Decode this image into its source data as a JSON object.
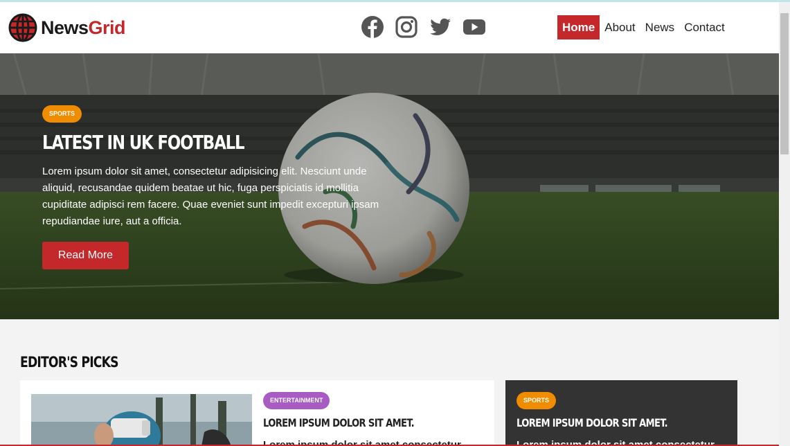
{
  "brand": {
    "name_part1": "News",
    "name_part2": "Grid",
    "accent": "#c4282a"
  },
  "social": [
    {
      "icon": "facebook-icon"
    },
    {
      "icon": "instagram-icon"
    },
    {
      "icon": "twitter-icon"
    },
    {
      "icon": "youtube-icon"
    }
  ],
  "nav": {
    "items": [
      "Home",
      "About",
      "News",
      "Contact"
    ],
    "active": "Home"
  },
  "hero": {
    "category": "Sports",
    "title": "Latest in UK Football",
    "text": "Lorem ipsum dolor sit amet, consectetur adipisicing elit. Nesciunt unde aliquid, recusandae quidem beatae ut hic, fuga perspiciatis id mollitia cupiditate adipisci rem facere. Quae eveniet sunt impedit excepturi ipsam repudiandae iure, aut a officia.",
    "button": "Read More"
  },
  "picks": {
    "heading": "Editor's Picks",
    "cards": [
      {
        "category": "Entertainment",
        "title": "Lorem ipsum dolor sit amet.",
        "text": "Lorem ipsum dolor sit amet consectetur"
      },
      {
        "category": "Sports",
        "title": "Lorem ipsum dolor sit amet.",
        "text": "Lorem ipsum dolor sit amet consectetur"
      }
    ]
  },
  "colors": {
    "sports": "#f08c00",
    "entertainment": "#a95bc4",
    "dark_card": "#333333"
  }
}
